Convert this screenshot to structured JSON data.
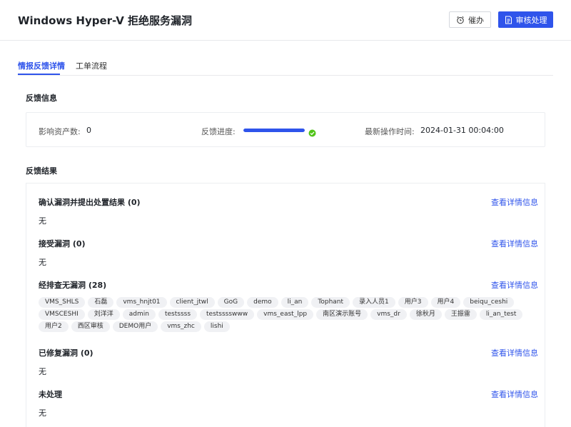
{
  "header": {
    "title": "Windows Hyper-V 拒绝服务漏洞",
    "remind_label": "催办",
    "review_label": "审核处理"
  },
  "tabs": [
    {
      "label": "情报反馈详情",
      "active": true
    },
    {
      "label": "工单流程",
      "active": false
    }
  ],
  "feedback_info": {
    "section_title": "反馈信息",
    "asset_count_label": "影响资产数:",
    "asset_count": "0",
    "progress_label": "反馈进度:",
    "progress_value": 1.0,
    "last_op_label": "最新操作时间:",
    "last_op_time": "2024-01-31 00:04:00"
  },
  "feedback_result": {
    "section_title": "反馈结果",
    "groups": [
      {
        "title": "确认漏洞并提出处置结果 (0)",
        "link": "查看详情信息",
        "empty": "无"
      },
      {
        "title": "接受漏洞 (0)",
        "link": "查看详情信息",
        "empty": "无"
      },
      {
        "title": "经排查无漏洞 (28)",
        "link": "查看详情信息",
        "tags": [
          "VMS_SHLS",
          "石磊",
          "vms_hnjt01",
          "client_jtwl",
          "GoG",
          "demo",
          "li_an",
          "Tophant",
          "录入人员1",
          "用户3",
          "用户4",
          "beiqu_ceshi",
          "VMSCESHI",
          "刘洋洋",
          "admin",
          "testssss",
          "testsssswww",
          "vms_east_lpp",
          "南区演示账号",
          "vms_dr",
          "徐秋月",
          "王振雷",
          "li_an_test",
          "用户2",
          "西区审核",
          "DEMO用户",
          "vms_zhc",
          "lishi"
        ]
      },
      {
        "title": "已修复漏洞 (0)",
        "link": "查看详情信息",
        "empty": "无"
      },
      {
        "title": "未处理",
        "link": "查看详情信息",
        "empty": "无"
      }
    ]
  },
  "colors": {
    "primary": "#2f54eb",
    "success": "#52c41a",
    "border": "#eceef1",
    "tag_bg": "#f0f1f4"
  },
  "icons": {
    "remind": "alarm-clock-icon",
    "review": "document-icon",
    "progress_done": "check-circle-icon"
  }
}
